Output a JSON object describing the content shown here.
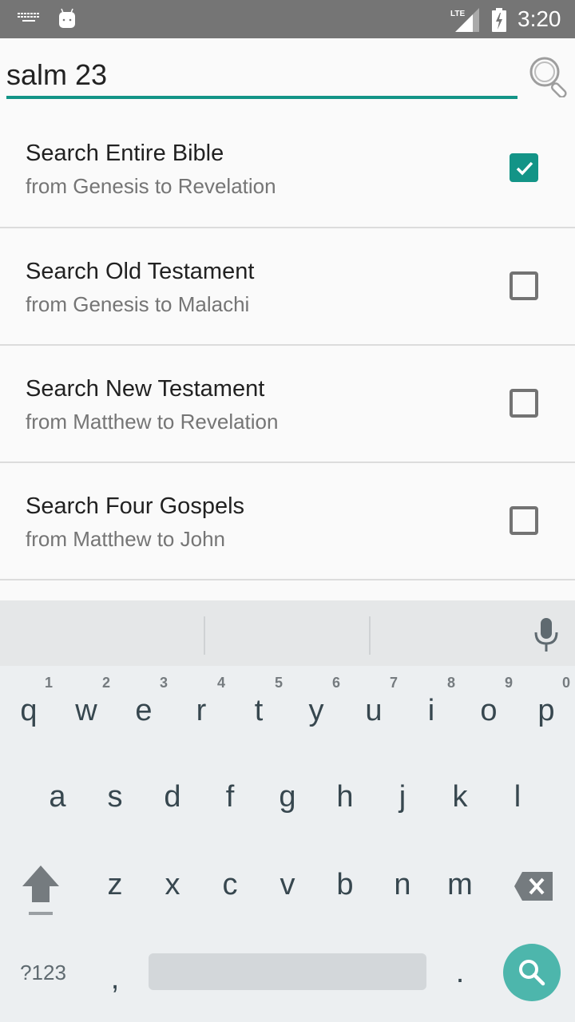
{
  "status_bar": {
    "time": "3:20",
    "network_label": "LTE",
    "icons": [
      "keyboard-icon",
      "android-icon",
      "lte-signal-icon",
      "battery-charging-icon"
    ]
  },
  "search": {
    "query": "salm 23",
    "placeholder": "",
    "button_icon": "magnifier-icon",
    "accent_color": "#139487"
  },
  "options": [
    {
      "title": "Search Entire Bible",
      "subtitle": "from Genesis to Revelation",
      "checked": true
    },
    {
      "title": "Search Old Testament",
      "subtitle": "from Genesis to Malachi",
      "checked": false
    },
    {
      "title": "Search New Testament",
      "subtitle": "from Matthew to Revelation",
      "checked": false
    },
    {
      "title": "Search Four Gospels",
      "subtitle": "from Matthew to John",
      "checked": false
    }
  ],
  "keyboard": {
    "suggestions": [
      "",
      "",
      ""
    ],
    "mic_icon": "microphone-icon",
    "row1": [
      {
        "key": "q",
        "hint": "1"
      },
      {
        "key": "w",
        "hint": "2"
      },
      {
        "key": "e",
        "hint": "3"
      },
      {
        "key": "r",
        "hint": "4"
      },
      {
        "key": "t",
        "hint": "5"
      },
      {
        "key": "y",
        "hint": "6"
      },
      {
        "key": "u",
        "hint": "7"
      },
      {
        "key": "i",
        "hint": "8"
      },
      {
        "key": "o",
        "hint": "9"
      },
      {
        "key": "p",
        "hint": "0"
      }
    ],
    "row2": [
      "a",
      "s",
      "d",
      "f",
      "g",
      "h",
      "j",
      "k",
      "l"
    ],
    "row3": [
      "z",
      "x",
      "c",
      "v",
      "b",
      "n",
      "m"
    ],
    "symbols_label": "?123",
    "comma": ",",
    "period": ".",
    "shift_icon": "shift-icon",
    "delete_icon": "backspace-icon",
    "action_icon": "search-icon",
    "action_color": "#4db6ac"
  }
}
